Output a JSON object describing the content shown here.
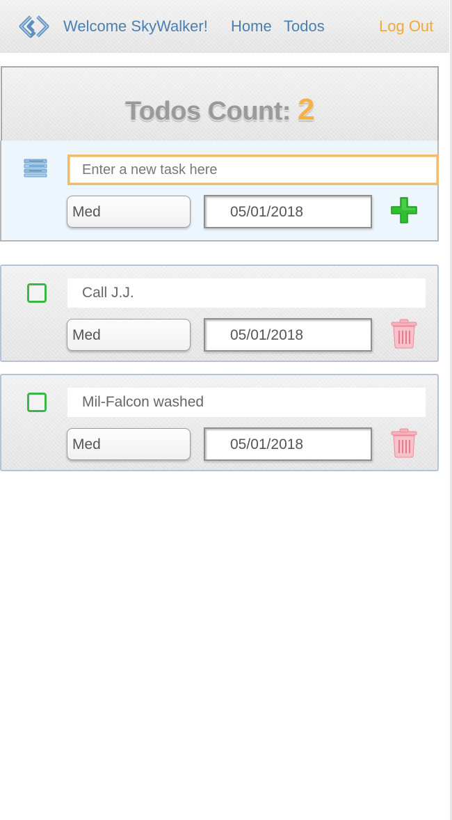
{
  "nav": {
    "welcome": "Welcome SkyWalker!",
    "home": "Home",
    "todos": "Todos",
    "logout": "Log Out",
    "logo_icon": "diamond-link-logo-icon"
  },
  "counter": {
    "label": "Todos Count:",
    "value": "2"
  },
  "new_task": {
    "placeholder": "Enter a new task here",
    "priority": "Med",
    "date": "05/01/2018",
    "list_icon": "list-lines-icon",
    "add_icon": "plus-icon"
  },
  "todos": [
    {
      "text": "Call J.J.",
      "priority": "Med",
      "date": "05/01/2018",
      "done": false
    },
    {
      "text": "Mil-Falcon washed",
      "priority": "Med",
      "date": "05/01/2018",
      "done": false
    }
  ],
  "colors": {
    "link": "#4a7fb0",
    "logout": "#f0a838",
    "count_number": "#f5b04a",
    "add_green": "#2fbf2f",
    "trash_pink": "#f6aab4",
    "checkbox_green": "#3cb54a"
  }
}
